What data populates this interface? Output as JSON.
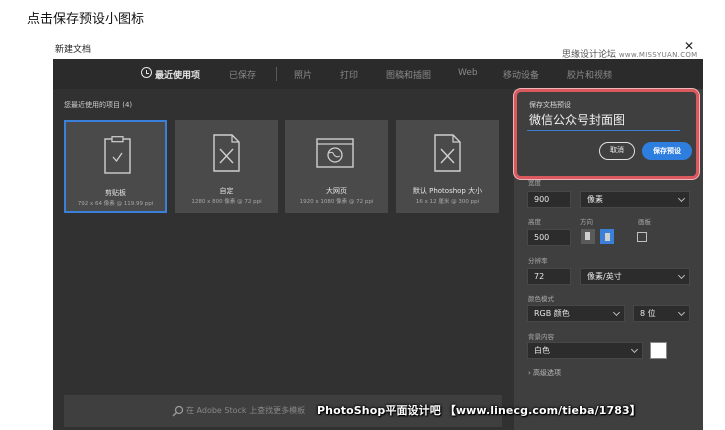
{
  "caption": "点击保存预设小图标",
  "dialog_title": "新建文档",
  "watermark_top": {
    "cn": "思缘设计论坛",
    "en": "www.MISSYUAN.COM"
  },
  "tabs": [
    {
      "label": "最近使用项",
      "active": true
    },
    {
      "label": "已保存"
    },
    {
      "label": "照片"
    },
    {
      "label": "打印"
    },
    {
      "label": "图稿和插图"
    },
    {
      "label": "Web"
    },
    {
      "label": "移动设备"
    },
    {
      "label": "胶片和视频"
    }
  ],
  "recent": {
    "title": "您最近使用的项目 (4)"
  },
  "cards": [
    {
      "name": "剪贴板",
      "desc": "792 x 64 像素 @ 119.99 ppi",
      "icon": "clipboard-icon"
    },
    {
      "name": "自定",
      "desc": "1280 x 800 像素 @ 72 ppi",
      "icon": "document-icon"
    },
    {
      "name": "大网页",
      "desc": "1920 x 1080 像素 @ 72 ppi",
      "icon": "web-page-icon"
    },
    {
      "name": "默认 Photoshop 大小",
      "desc": "16 x 12 厘米 @ 300 ppi",
      "icon": "document-icon"
    }
  ],
  "search": {
    "placeholder": "在 Adobe Stock 上查找更多模板"
  },
  "preset": {
    "label": "保存文档预设",
    "value": "微信公众号封面图",
    "cancel": "取消",
    "save": "保存预设"
  },
  "fields": {
    "width_label": "宽度",
    "width_value": "900",
    "width_unit": "像素",
    "height_label": "高度",
    "height_value": "500",
    "orientation_label": "方向",
    "artboard_label": "画板",
    "resolution_label": "分辨率",
    "resolution_value": "72",
    "resolution_unit": "像素/英寸",
    "color_mode_label": "颜色模式",
    "color_mode_value": "RGB 颜色",
    "bit_depth": "8 位",
    "background_label": "背景内容",
    "background_value": "白色",
    "advanced": "高级选项"
  },
  "watermark_bottom": "PhotoShop平面设计吧 【www.linecg.com/tieba/1783】",
  "colors": {
    "accent": "#2e7ee0",
    "highlight": "#d9595f",
    "panel": "#3f3f3f",
    "background": "#313131"
  }
}
